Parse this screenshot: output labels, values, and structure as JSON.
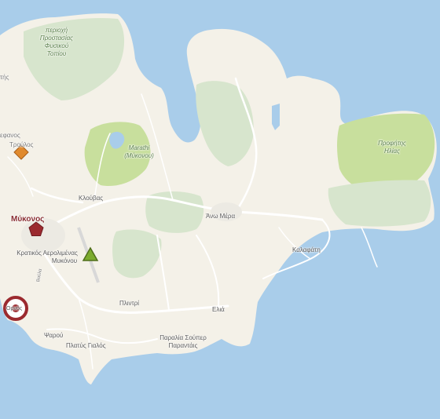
{
  "map": {
    "colors": {
      "sea": "#a9cdea",
      "land": "#f4f1e8",
      "park": "#c8df9d",
      "park_light": "#d7e5cd",
      "road": "#ffffff",
      "town_marker": "#9b2a2f",
      "triangle_marker": "#7cab2e",
      "diamond_marker": "#e08a2e",
      "ring_marker": "#9b2a2f"
    },
    "labels": {
      "protected_area": [
        "περιοχή",
        "Προστασίας",
        "Φυσικού",
        "Τοπίου"
      ],
      "marathi": [
        "Marathi",
        "(Μύκονου)"
      ],
      "profitis_ilias": [
        "Προφήτης",
        "Ηλίας"
      ],
      "trullos": "Τρούλος",
      "stefanos": "εφανος",
      "ktis": "τής",
      "klouvas": "Κλούβας",
      "mykonos": "Μύκονος",
      "airport": [
        "Κρατικός Αερολιμένας",
        "Μυκόνου"
      ],
      "ano_mera": "Άνω Μέρα",
      "kalafati": "Καλαφάτη",
      "plintri": "Πλιντρί",
      "elia": "Ελιά",
      "psarou": "Ψαρού",
      "platis_gialos": "Πλατύς Γιαλός",
      "paralia": [
        "Παραλία Σούπερ",
        "Παραντάις"
      ],
      "ring_town": "Ορνός",
      "road_label": "Βούλα"
    },
    "markers": [
      {
        "name": "mykonos-town-marker",
        "shape": "pentagon"
      },
      {
        "name": "airport-marker",
        "shape": "triangle"
      },
      {
        "name": "trullos-marker",
        "shape": "diamond"
      },
      {
        "name": "ornos-marker",
        "shape": "ring"
      }
    ]
  }
}
